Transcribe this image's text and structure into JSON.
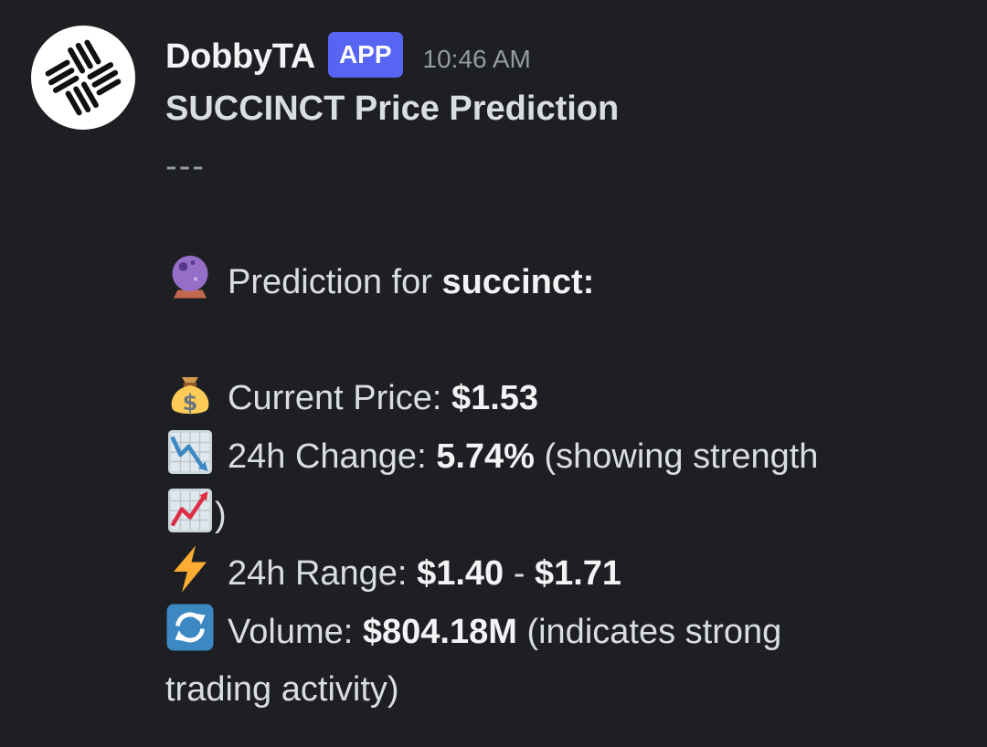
{
  "message": {
    "author": "DobbyTA",
    "badge": "APP",
    "timestamp": "10:46 AM",
    "title": "SUCCINCT Price Prediction",
    "separator": "---",
    "prediction": {
      "icon": "crystal-ball-icon",
      "label": "Prediction for ",
      "value": "succinct:"
    },
    "current_price": {
      "icon": "money-bag-icon",
      "label": "Current Price: ",
      "value": "$1.53"
    },
    "change_24h": {
      "icon": "chart-decreasing-icon",
      "label": "24h Change: ",
      "value": "5.74%",
      "suffix": " (showing strength",
      "trail_icon": "chart-increasing-icon",
      "trail_text": ")"
    },
    "range_24h": {
      "icon": "lightning-icon",
      "label": "24h Range: ",
      "low": "$1.40",
      "dash": " - ",
      "high": "$1.71"
    },
    "volume": {
      "icon": "refresh-arrows-icon",
      "label": "Volume: ",
      "value": "$804.18M",
      "suffix": " (indicates strong trading activity)"
    }
  },
  "colors": {
    "background": "#1e1f22",
    "badge": "#5865f2",
    "text": "#dbdee1",
    "muted": "#949ba4"
  }
}
